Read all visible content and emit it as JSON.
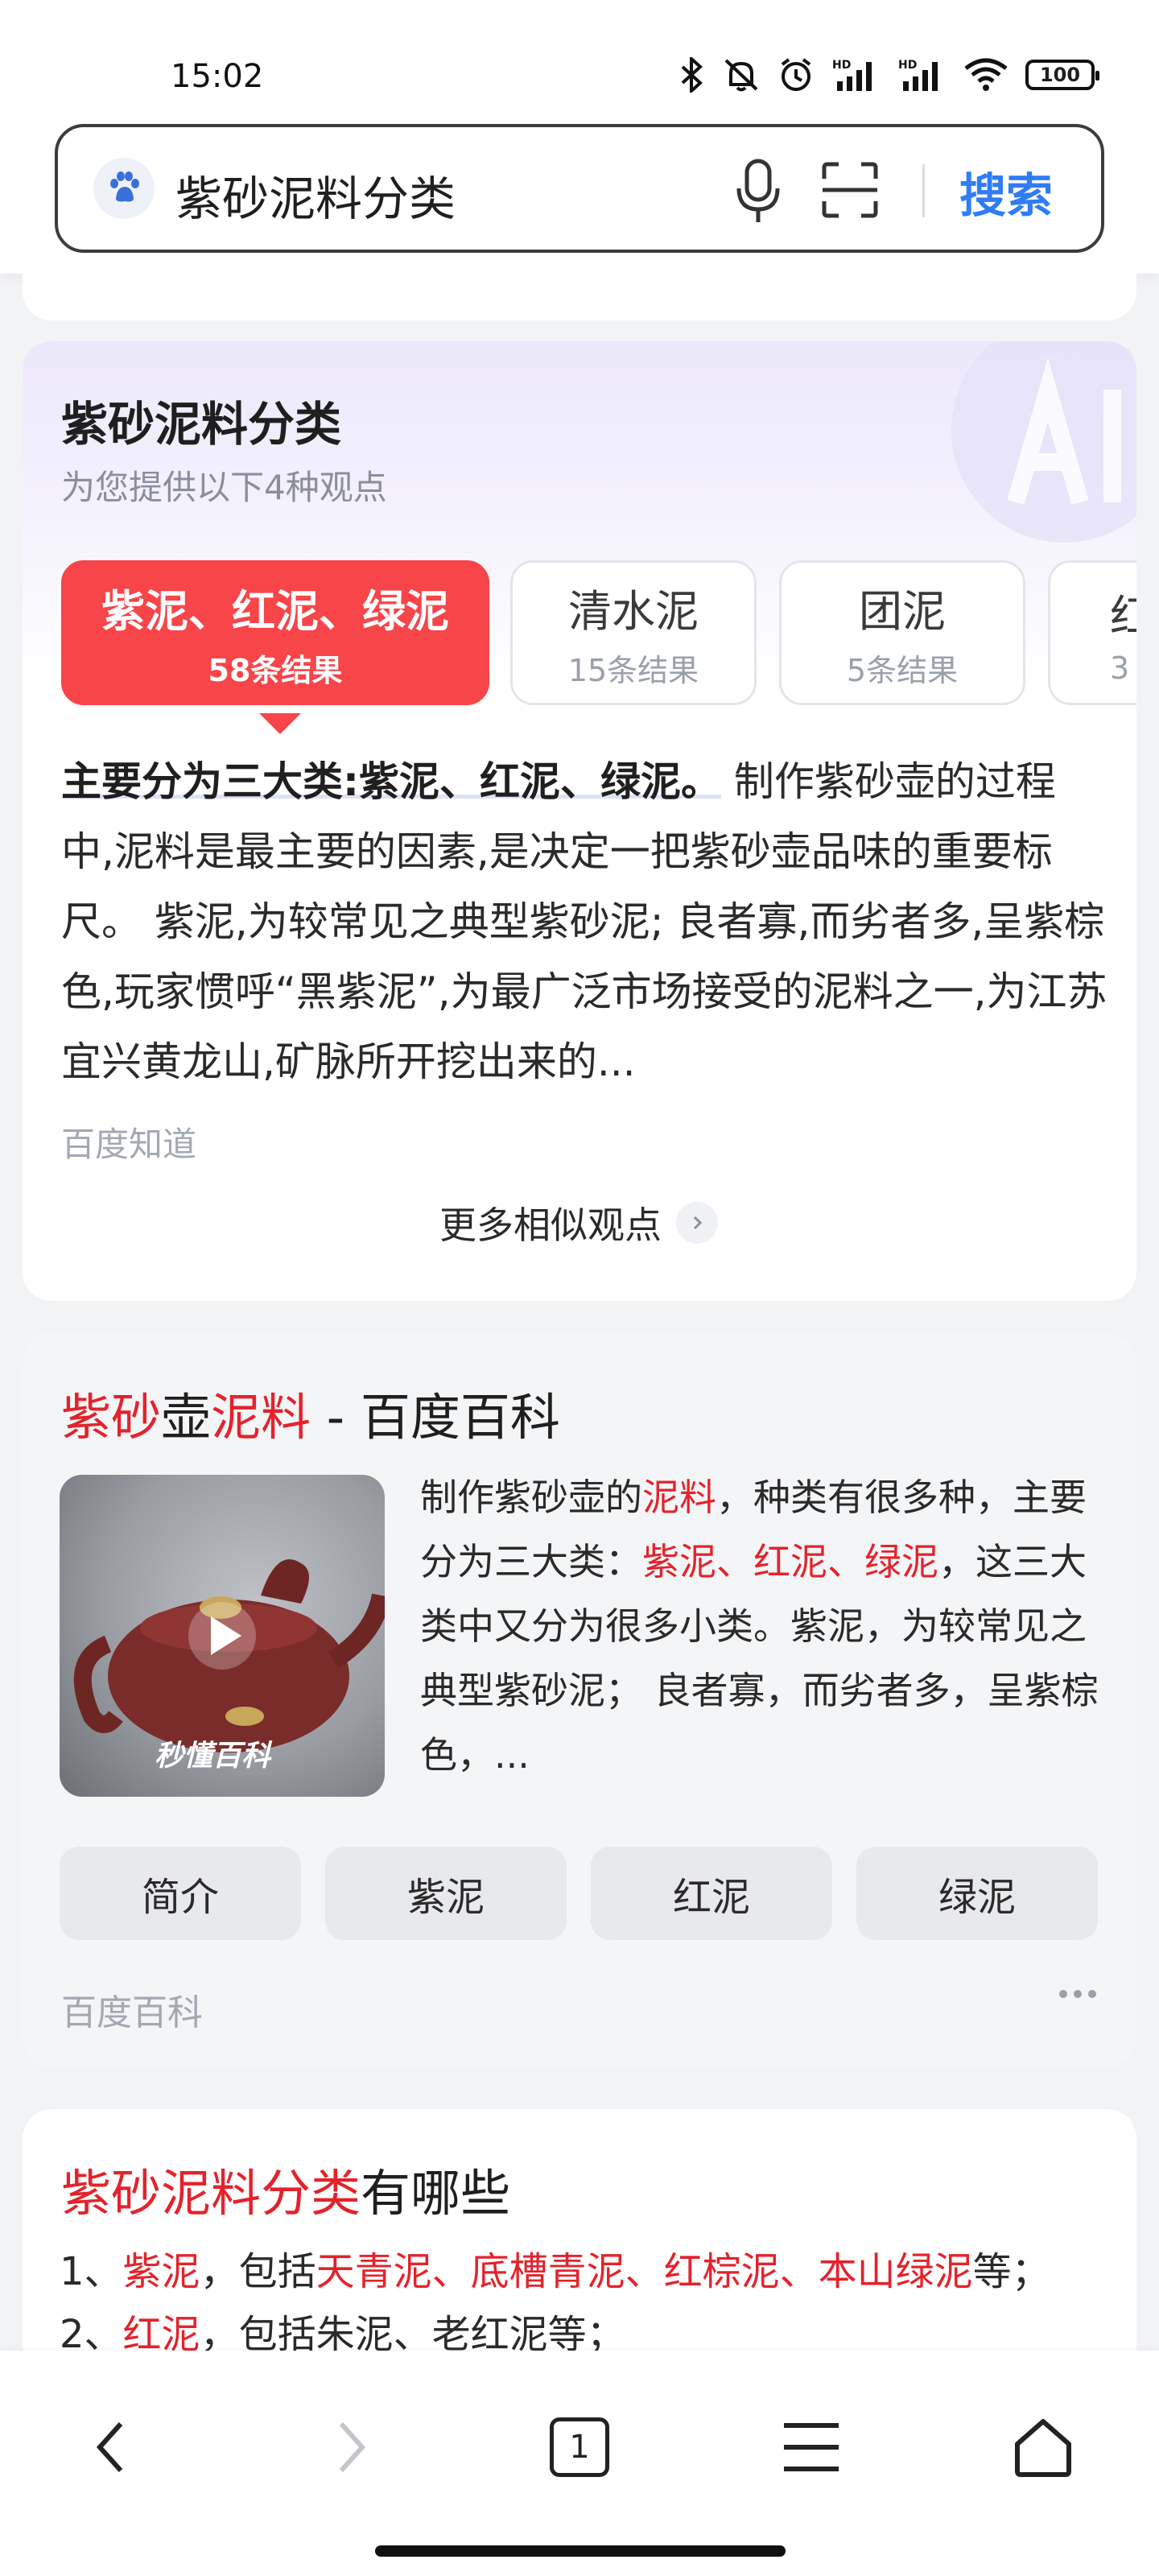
{
  "status_bar": {
    "time": "15:02",
    "battery": "100",
    "icons": [
      "bluetooth-icon",
      "mute-icon",
      "alarm-icon",
      "signal-hd-icon",
      "signal-hd-icon",
      "wifi-icon"
    ]
  },
  "search": {
    "query": "紫砂泥料分类",
    "button_label": "搜索",
    "icons": [
      "baidu-paw-icon",
      "mic-icon",
      "scan-icon"
    ]
  },
  "ai_card": {
    "title": "紫砂泥料分类",
    "subtitle": "为您提供以下4种观点",
    "tabs": [
      {
        "label": "紫泥、红泥、绿泥",
        "count": "58条结果",
        "active": true
      },
      {
        "label": "清水泥",
        "count": "15条结果",
        "active": false
      },
      {
        "label": "团泥",
        "count": "5条结果",
        "active": false
      },
      {
        "label": "红",
        "count": "3",
        "active": false
      }
    ],
    "answer_highlight": "主要分为三大类:紫泥、红泥、绿泥。",
    "answer_body": "制作紫砂壶的过程中,泥料是最主要的因素,是决定一把紫砂壶品味的重要标尺。 紫泥,为较常见之典型紫砂泥; 良者寡,而劣者多,呈紫棕色,玩家惯呼“黑紫泥”,为最广泛市场接受的泥料之一,为江苏宜兴黄龙山,矿脉所开挖出来的...",
    "source": "百度知道",
    "more_label": "更多相似观点"
  },
  "baike_card": {
    "title_parts": [
      {
        "text": "紫砂",
        "red": true
      },
      {
        "text": "壶",
        "red": false
      },
      {
        "text": "泥料",
        "red": true
      },
      {
        "text": " - 百度百科",
        "red": false
      }
    ],
    "thumbnail_watermark": "秒懂百科",
    "desc_parts": [
      {
        "text": "制作紫砂壶的",
        "red": false
      },
      {
        "text": "泥料",
        "red": true
      },
      {
        "text": "，种类有很多种，主要分为三大类：",
        "red": false
      },
      {
        "text": "紫泥、红泥、绿泥",
        "red": true
      },
      {
        "text": "，这三大类中又分为很多小类。紫泥，为较常见之典型紫砂泥； 良者寡，而劣者多，呈紫棕色，...",
        "red": false
      }
    ],
    "chips": [
      "简介",
      "紫泥",
      "红泥",
      "绿泥"
    ],
    "source": "百度百科"
  },
  "list_card": {
    "title_red": "紫砂泥料分类",
    "title_rest": "有哪些",
    "line1_parts": [
      {
        "text": "1、",
        "red": false
      },
      {
        "text": "紫泥",
        "red": true
      },
      {
        "text": "，包括",
        "red": false
      },
      {
        "text": "天青泥、底槽青泥、红棕泥、本山绿泥",
        "red": true
      },
      {
        "text": "等；",
        "red": false
      }
    ],
    "line2_parts": [
      {
        "text": "2、",
        "red": false
      },
      {
        "text": "红泥",
        "red": true
      },
      {
        "text": "，包括朱泥、老红泥等；",
        "red": false
      }
    ]
  },
  "bottom_nav": {
    "tab_count": "1",
    "icons": [
      "back-icon",
      "forward-icon",
      "tabs-icon",
      "menu-icon",
      "home-icon"
    ]
  },
  "colors": {
    "accent_blue": "#2f7cf6",
    "accent_red": "#f7454a",
    "highlight_red": "#e3232c"
  }
}
